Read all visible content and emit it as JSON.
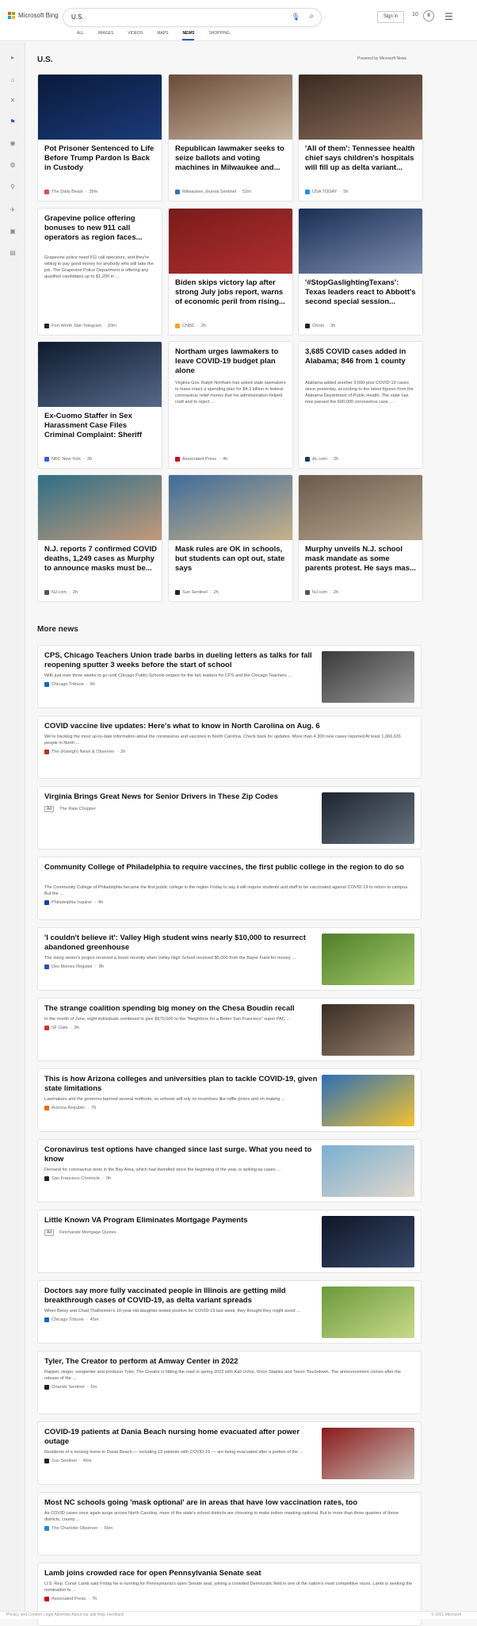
{
  "header": {
    "logo_text": "Microsoft Bing",
    "query": "U.S.",
    "signin": "Sign in",
    "rewards": "10",
    "tabs": [
      "ALL",
      "IMAGES",
      "VIDEOS",
      "MAPS",
      "NEWS",
      "SHOPPING"
    ],
    "active_tab": "NEWS"
  },
  "rail_icons": [
    "chevron-right",
    "home",
    "tools",
    "flag",
    "location",
    "globe",
    "person",
    "rocket",
    "box",
    "car"
  ],
  "section": {
    "title": "U.S.",
    "powered": "Powered by Microsoft News"
  },
  "cards": [
    {
      "title": "Pot Prisoner Sentenced to Life Before Trump Pardon Is Back in Custody",
      "source": "The Daily Beast",
      "age": "39m",
      "color": "#e5484d",
      "img": [
        "#0a1a3a",
        "#1b3b7a"
      ],
      "has_image": true
    },
    {
      "title": "Republican lawmaker seeks to seize ballots and voting machines in Milwaukee and...",
      "source": "Milwaukee Journal Sentinel",
      "age": "52m",
      "color": "#2f74c0",
      "img": [
        "#6b4a3a",
        "#c9b7a0"
      ],
      "has_image": true
    },
    {
      "title": "'All of them': Tennessee health chief says children's hospitals will fill up as delta variant...",
      "source": "USA TODAY",
      "age": "5h",
      "color": "#1e90ff",
      "img": [
        "#3a2a22",
        "#8e6f5c"
      ],
      "has_image": true
    },
    {
      "title": "Grapevine police offering bonuses to new 911 call operators as region faces...",
      "desc": "Grapevine police need 911 call operators, and they're willing to pay good money for anybody who will take the job. The Grapevine Police Department is offering any qualified candidates up to $1,200 in ...",
      "source": "Fort Worth Star-Telegram",
      "age": "20m",
      "color": "#222",
      "has_image": false
    },
    {
      "title": "Biden skips victory lap after strong July jobs report, warns of economic peril from rising...",
      "source": "CNBC",
      "age": "2h",
      "color": "#f5a623",
      "img": [
        "#7a1a1a",
        "#b03030"
      ],
      "has_image": true
    },
    {
      "title": "'#StopGaslightingTexans': Texas leaders react to Abbott's second special session...",
      "source": "Chron",
      "age": "3h",
      "color": "#222",
      "img": [
        "#1a2e55",
        "#7c8fb0"
      ],
      "has_image": true
    },
    {
      "title": "Ex-Cuomo Staffer in Sex Harassment Case Files Criminal Complaint: Sheriff",
      "source": "NBC New York",
      "age": "3h",
      "color": "#3b5bdb",
      "img": [
        "#0e1a2e",
        "#556a8a"
      ],
      "has_image": true
    },
    {
      "title": "Northam urges lawmakers to leave COVID-19 budget plan alone",
      "desc": "Virginia Gov. Ralph Northam has asked state lawmakers to leave intact a spending plan for $4.3 billion in federal coronavirus relief money that his administration helped craft and to reject ...",
      "source": "Associated Press",
      "age": "4h",
      "color": "#d0021b",
      "has_image": false
    },
    {
      "title": "3,685 COVID cases added in Alabama; 846 from 1 county",
      "desc": "Alabama added another 3,600-plus COVID-19 cases since yesterday, according to the latest figures from the Alabama Department of Public Health. The state has now passed the 600,000 coronavirus case ...",
      "source": "AL.com",
      "age": "2h",
      "color": "#1b3a6b",
      "has_image": false
    },
    {
      "title": "N.J. reports 7 confirmed COVID deaths, 1,249 cases as Murphy to announce masks must be...",
      "source": "NJ.com",
      "age": "2h",
      "color": "#555",
      "img": [
        "#2e6f86",
        "#c49a7b"
      ],
      "has_image": true
    },
    {
      "title": "Mask rules are OK in schools, but students can opt out, state says",
      "source": "Sun Sentinel",
      "age": "2h",
      "color": "#222",
      "img": [
        "#3f6b9a",
        "#c8b28a"
      ],
      "has_image": true
    },
    {
      "title": "Murphy unveils N.J. school mask mandate as some parents protest. He says mas...",
      "source": "NJ.com",
      "age": "2h",
      "color": "#555",
      "img": [
        "#6b5a4a",
        "#b8a890"
      ],
      "has_image": true
    }
  ],
  "more_news": {
    "title": "More news",
    "items": [
      {
        "title": "CPS, Chicago Teachers Union trade barbs in dueling letters as talks for fall reopening sputter 3 weeks before the start of school",
        "desc": "With just over three weeks to go until Chicago Public Schools reopen for the fall, leaders for CPS and the Chicago Teachers ...",
        "source": "Chicago Tribune",
        "age": "6h",
        "color": "#1565c0",
        "ad": false,
        "img": [
          "#3a3a3a",
          "#9a9a9a"
        ]
      },
      {
        "title": "COVID vaccine live updates: Here's what to know in North Carolina on Aug. 6",
        "desc": "We're tracking the most up-to-date information about the coronavirus and vaccines in North Carolina. Check back for updates. More than 4,300 new cases reported At least 1,066,631 people in North ...",
        "source": "The (Raleigh) News & Observer",
        "age": "2h",
        "color": "#c62828",
        "ad": false,
        "img": null
      },
      {
        "title": "Virginia Brings Great News for Senior Drivers in These Zip Codes",
        "desc": "",
        "source": "The Rate Chopper",
        "age": "",
        "color": "",
        "ad": true,
        "ad_label": "Ad",
        "img": [
          "#1c2430",
          "#6a7582"
        ]
      },
      {
        "title": "Community College of Philadelphia to require vaccines, the first public college in the region to do so",
        "desc": "The Community College of Philadelphia became the first public college in the region Friday to say it will require students and staff to be vaccinated against COVID-19 to return to campus. But the ...",
        "source": "Philadelphia Inquirer",
        "age": "4h",
        "color": "#0d47a1",
        "ad": false,
        "img": null
      },
      {
        "title": "'I couldn't believe it': Valley High student wins nearly $10,000 to resurrect abandoned greenhouse",
        "desc": "The rising senior's project received a boost recently when Valley High School received $5,000 from the Bayer Fund for money ...",
        "source": "Des Moines Register",
        "age": "8h",
        "color": "#3949ab",
        "ad": false,
        "img": [
          "#4f7f2a",
          "#a5c96a"
        ]
      },
      {
        "title": "The strange coalition spending big money on the Chesa Boudin recall",
        "desc": "In the month of June, eight individuals combined to give $670,000 to the \"Neighbors for a Better San Francisco\" super PAC ...",
        "source": "SF Gate",
        "age": "9h",
        "color": "#d32f2f",
        "ad": false,
        "img": [
          "#3a2e24",
          "#9b8572"
        ]
      },
      {
        "title": "This is how Arizona colleges and universities plan to tackle COVID-19, given state limitations",
        "desc": "Lawmakers and the governor banned several methods, so schools will rely on incentives like raffle prizes and on making ...",
        "source": "Arizona Republic",
        "age": "7h",
        "color": "#ef6c00",
        "ad": false,
        "img": [
          "#2d6fb5",
          "#f2c230"
        ]
      },
      {
        "title": "Coronavirus test options have changed since last surge. What you need to know",
        "desc": "Demand for coronavirus tests in the Bay Area, which had dwindled since the beginning of the year, is spiking as cases ...",
        "source": "San Francisco Chronicle",
        "age": "9h",
        "color": "#222",
        "ad": false,
        "img": [
          "#7ab0d0",
          "#e0d6cc"
        ]
      },
      {
        "title": "Little Known VA Program Eliminates Mortgage Payments",
        "desc": "",
        "source": "Fetcharate Mortgage Quotes",
        "age": "",
        "color": "",
        "ad": true,
        "ad_label": "Ad",
        "img": [
          "#0e1628",
          "#3a4a6a"
        ]
      },
      {
        "title": "Doctors say more fully vaccinated people in Illinois are getting mild breakthrough cases of COVID-19, as delta variant spreads",
        "desc": "When Betsy and Chad Thalheimer's 10-year-old daughter tested positive for COVID-19 last week, they thought they might avoid ...",
        "source": "Chicago Tribune",
        "age": "45m",
        "color": "#1565c0",
        "ad": false,
        "img": [
          "#6a9a3a",
          "#c9d98a"
        ]
      },
      {
        "title": "Tyler, The Creator to perform at Amway Center in 2022",
        "desc": "Rapper, singer, songwriter and producer Tyler, The Creator is hitting the road in spring 2022 with Kali Uchis, Vince Staples and Teezo Touchdown. The announcement comes after the release of the ...",
        "source": "Orlando Sentinel",
        "age": "6m",
        "color": "#222",
        "ad": false,
        "img": null
      },
      {
        "title": "COVID-19 patients at Dania Beach nursing home evacuated after power outage",
        "desc": "Residents of a nursing home in Dania Beach — including 13 patients with COVID-19 — are being evacuated after a portion of the ...",
        "source": "Sun Sentinel",
        "age": "46m",
        "color": "#222",
        "ad": false,
        "img": [
          "#8a1a1a",
          "#c8c0b8"
        ]
      },
      {
        "title": "Most NC schools going 'mask optional' are in areas that have low vaccination rates, too",
        "desc": "As COVID cases once again surge across North Carolina, more of the state's school districts are choosing to make indoor masking optional. But in more than three quarters of those districts, county ...",
        "source": "The Charlotte Observer",
        "age": "56m",
        "color": "#1e88e5",
        "ad": false,
        "img": null
      },
      {
        "title": "Lamb joins crowded race for open Pennsylvania Senate seat",
        "desc": "U.S. Rep. Conor Lamb said Friday he is running for Pennsylvania's open Senate seat, joining a crowded Democratic field in one of the nation's most competitive races. Lamb is seeking the nomination to ...",
        "source": "Associated Press",
        "age": "7h",
        "color": "#d0021b",
        "ad": false,
        "img": null
      }
    ]
  },
  "footer": {
    "left": "Privacy and Cookies   Legal   Advertise   About our ads   Help   Feedback",
    "right": "© 2021 Microsoft"
  }
}
